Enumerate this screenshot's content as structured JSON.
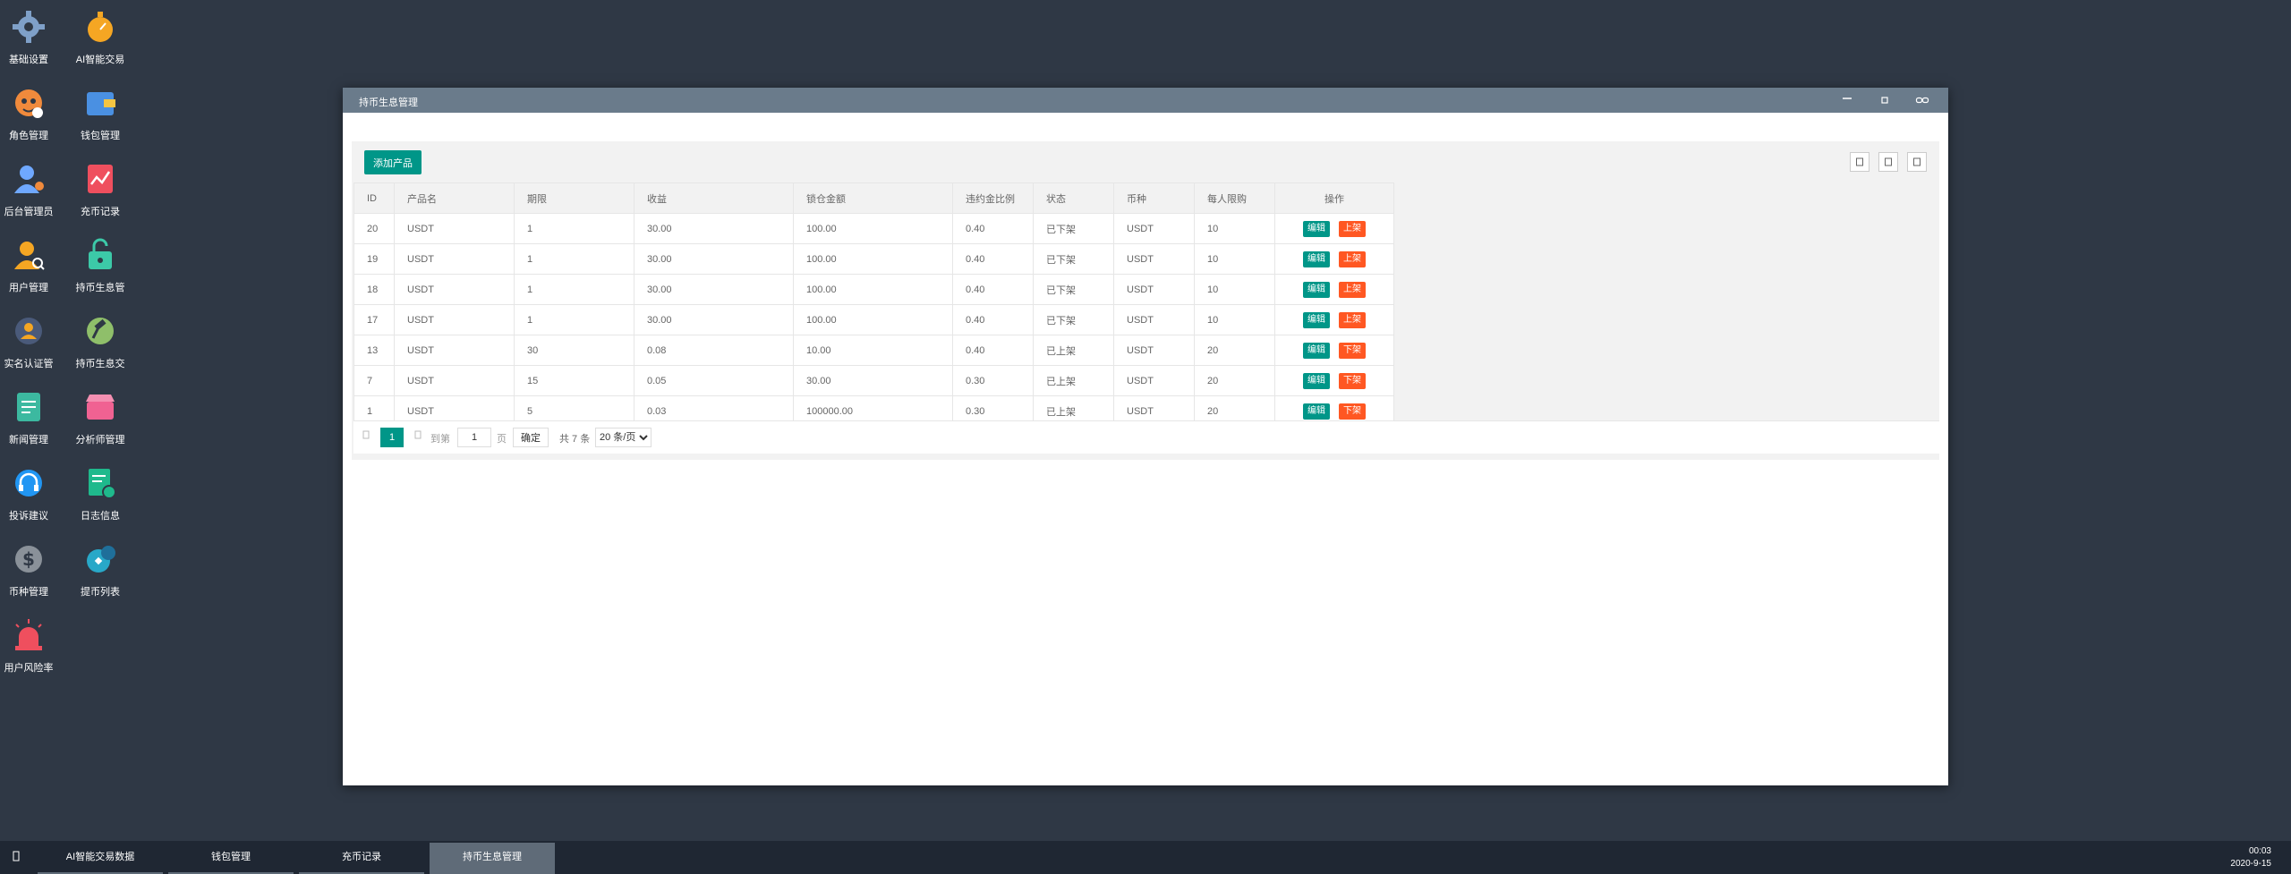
{
  "desktop": {
    "icons": [
      {
        "label": "基础设置",
        "icon": "gear-icon"
      },
      {
        "label": "AI智能交易",
        "icon": "stopwatch-icon"
      },
      {
        "label": "角色管理",
        "icon": "role-icon"
      },
      {
        "label": "钱包管理",
        "icon": "wallet-icon"
      },
      {
        "label": "后台管理员",
        "icon": "admin-icon"
      },
      {
        "label": "充币记录",
        "icon": "chart-record-icon"
      },
      {
        "label": "用户管理",
        "icon": "user-search-icon"
      },
      {
        "label": "持币生息管",
        "icon": "unlock-icon"
      },
      {
        "label": "实名认证管",
        "icon": "verified-user-icon"
      },
      {
        "label": "持币生息交",
        "icon": "hammer-icon"
      },
      {
        "label": "新闻管理",
        "icon": "news-icon"
      },
      {
        "label": "分析师管理",
        "icon": "shop-icon"
      },
      {
        "label": "投诉建议",
        "icon": "headset-icon"
      },
      {
        "label": "日志信息",
        "icon": "log-icon"
      },
      {
        "label": "币种管理",
        "icon": "dollar-icon"
      },
      {
        "label": "提币列表",
        "icon": "withdraw-icon"
      },
      {
        "label": "用户风险率",
        "icon": "alarm-icon"
      }
    ]
  },
  "window": {
    "title": "持币生息管理",
    "colors": {
      "titlebar": "#6a7b8b",
      "primary": "#009688",
      "danger": "#ff5722"
    }
  },
  "toolbar": {
    "add_label": "添加产品"
  },
  "table": {
    "headers": [
      "ID",
      "产品名",
      "期限",
      "收益",
      "锁仓金额",
      "违约金比例",
      "状态",
      "币种",
      "每人限购",
      "操作"
    ],
    "rows": [
      {
        "id": "20",
        "name": "USDT",
        "term": "1",
        "profit": "30.00",
        "amount": "100.00",
        "penalty": "0.40",
        "status": "已下架",
        "coin": "USDT",
        "limit": "10",
        "edit": "编辑",
        "toggle": "上架"
      },
      {
        "id": "19",
        "name": "USDT",
        "term": "1",
        "profit": "30.00",
        "amount": "100.00",
        "penalty": "0.40",
        "status": "已下架",
        "coin": "USDT",
        "limit": "10",
        "edit": "编辑",
        "toggle": "上架"
      },
      {
        "id": "18",
        "name": "USDT",
        "term": "1",
        "profit": "30.00",
        "amount": "100.00",
        "penalty": "0.40",
        "status": "已下架",
        "coin": "USDT",
        "limit": "10",
        "edit": "编辑",
        "toggle": "上架"
      },
      {
        "id": "17",
        "name": "USDT",
        "term": "1",
        "profit": "30.00",
        "amount": "100.00",
        "penalty": "0.40",
        "status": "已下架",
        "coin": "USDT",
        "limit": "10",
        "edit": "编辑",
        "toggle": "上架"
      },
      {
        "id": "13",
        "name": "USDT",
        "term": "30",
        "profit": "0.08",
        "amount": "10.00",
        "penalty": "0.40",
        "status": "已上架",
        "coin": "USDT",
        "limit": "20",
        "edit": "编辑",
        "toggle": "下架"
      },
      {
        "id": "7",
        "name": "USDT",
        "term": "15",
        "profit": "0.05",
        "amount": "30.00",
        "penalty": "0.30",
        "status": "已上架",
        "coin": "USDT",
        "limit": "20",
        "edit": "编辑",
        "toggle": "下架"
      },
      {
        "id": "1",
        "name": "USDT",
        "term": "5",
        "profit": "0.03",
        "amount": "100000.00",
        "penalty": "0.30",
        "status": "已上架",
        "coin": "USDT",
        "limit": "20",
        "edit": "编辑",
        "toggle": "下架"
      }
    ]
  },
  "pagination": {
    "current": "1",
    "goto_label": "到第",
    "page_value": "1",
    "page_label": "页",
    "confirm_label": "确定",
    "total_label": "共 7 条",
    "size_selected": "20 条/页"
  },
  "taskbar": {
    "tabs": [
      "AI智能交易数据",
      "钱包管理",
      "充币记录",
      "持币生息管理"
    ],
    "active_index": 3,
    "time": "00:03",
    "date": "2020-9-15"
  }
}
